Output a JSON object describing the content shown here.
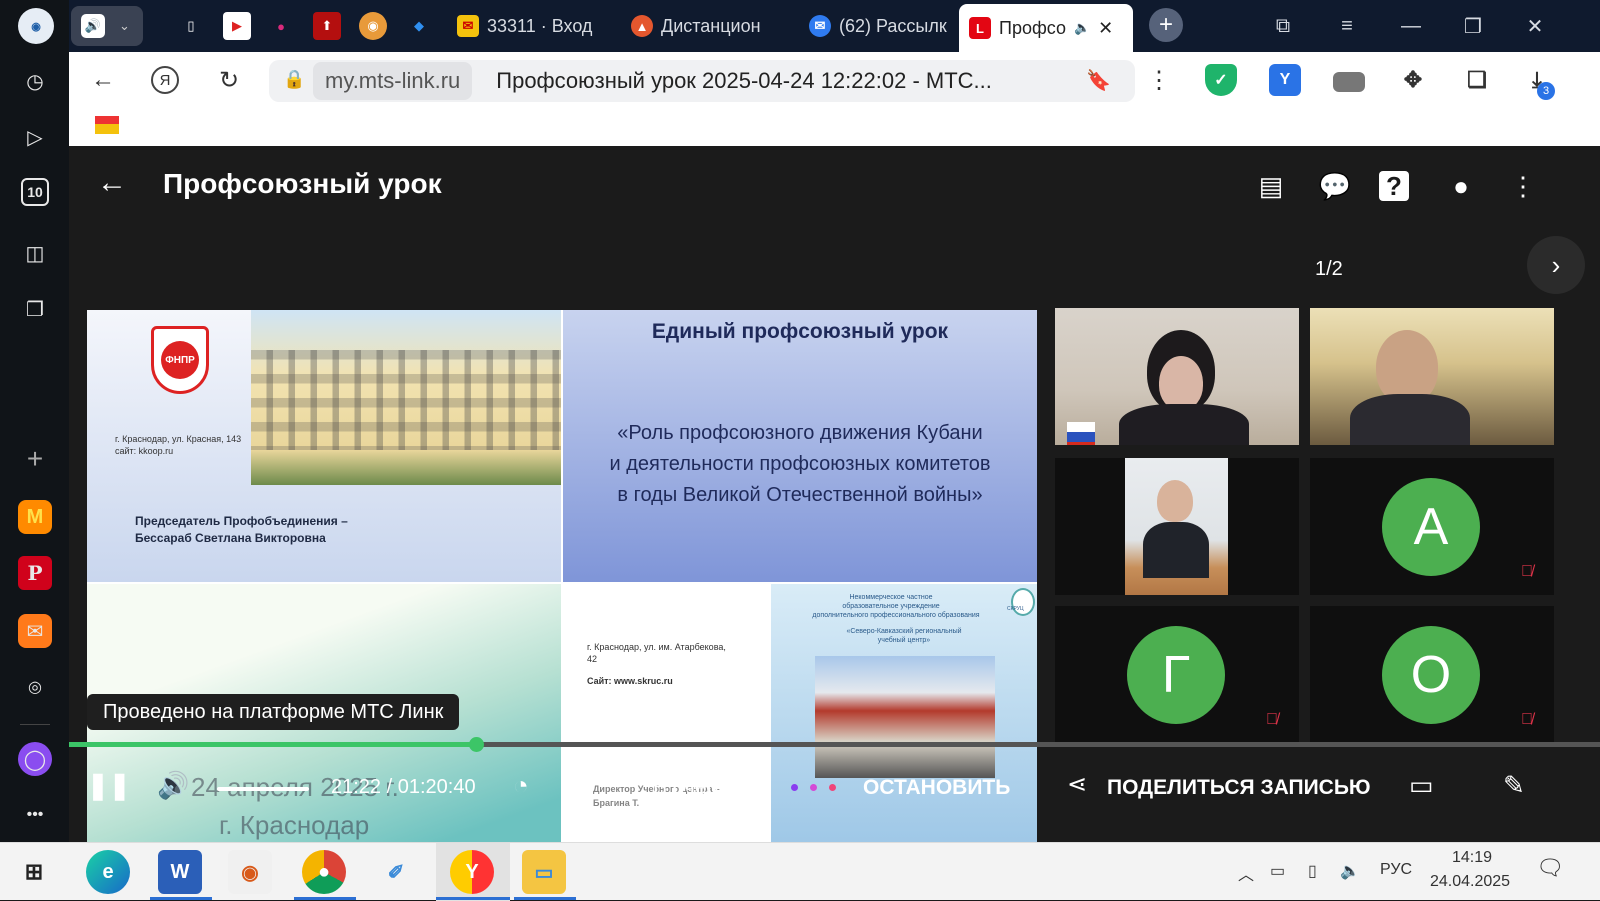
{
  "browser": {
    "tabs": [
      {
        "label": "33311 · Вход",
        "icon": "mail-icon",
        "color": "#f4c20d"
      },
      {
        "label": "Дистанцион",
        "icon": "triangle-icon",
        "color": "#e4572e"
      },
      {
        "label": "(62) Рассылк",
        "icon": "envelope-icon",
        "color": "#2f7bf0"
      },
      {
        "label": "Профсо",
        "icon": "mts-link-icon",
        "color": "#e30613"
      }
    ],
    "download_count": "3",
    "omnibox": {
      "host": "my.mts-link.ru",
      "page_title": "Профсоюзный урок 2025-04-24 12:22:02 - МТС..."
    }
  },
  "sidebar": {
    "counter_label": "10",
    "icons": [
      "clock-icon",
      "video-icon",
      "counter-icon",
      "screenshot-icon",
      "notes-icon",
      "add-icon",
      "music-icon",
      "news-icon",
      "mail-icon",
      "dot-icon",
      "alice-icon",
      "more-icon"
    ]
  },
  "player": {
    "title": "Профсоюзный урок",
    "pager": "1/2",
    "watermark": "Проведено на платформе МТС Линк",
    "time": "21:22 / 01:20:40",
    "progress": 0.266,
    "volume": 1.0,
    "queue_label": "В очереди",
    "stop_label": "ОСТАНОВИТЬ",
    "share_label": "ПОДЕЛИТЬСЯ ЗАПИСЬЮ",
    "dot_colors": [
      "#8a3df0",
      "#d44bd6",
      "#f0457a"
    ]
  },
  "slide": {
    "logo_text": "ФНПР",
    "address1": "г. Краснодар, ул. Красная, 143",
    "site1": "сайт: kkoop.ru",
    "chair_line1": "Председатель Профобъединения –",
    "chair_line2": "Бессараб Светлана Викторовна",
    "heading": "Единый профсоюзный урок",
    "subject_line1": "«Роль профсоюзного движения Кубани",
    "subject_line2": "и деятельности профсоюзных комитетов",
    "subject_line3": "в годы Великой Отечественной войны»",
    "address2_line1": "г. Краснодар, ул. им. Атарбекова,",
    "address2_line2": "42",
    "site2": "Сайт: www.skruc.ru",
    "org_line1": "Некоммерческое частное",
    "org_line2": "образовательное учреждение",
    "org_line3": "дополнительного профессионального образования",
    "org_line4": "«Северо-Кавказский региональный",
    "org_line5": "учебный центр»",
    "skruc_label": "СКРУЦ",
    "director_line1": "Директор Учебного центра –",
    "director_line2": "Брагина Т.",
    "date_line": "24 апреля 2025 г.",
    "city_line": "г. Краснодар"
  },
  "participants": [
    {
      "type": "video"
    },
    {
      "type": "video"
    },
    {
      "type": "video"
    },
    {
      "type": "avatar",
      "initial": "А",
      "muted": true
    },
    {
      "type": "avatar",
      "initial": "Г",
      "muted": true
    },
    {
      "type": "avatar",
      "initial": "О",
      "muted": true
    }
  ],
  "taskbar": {
    "lang": "РУС",
    "time": "14:19",
    "date": "24.04.2025"
  }
}
